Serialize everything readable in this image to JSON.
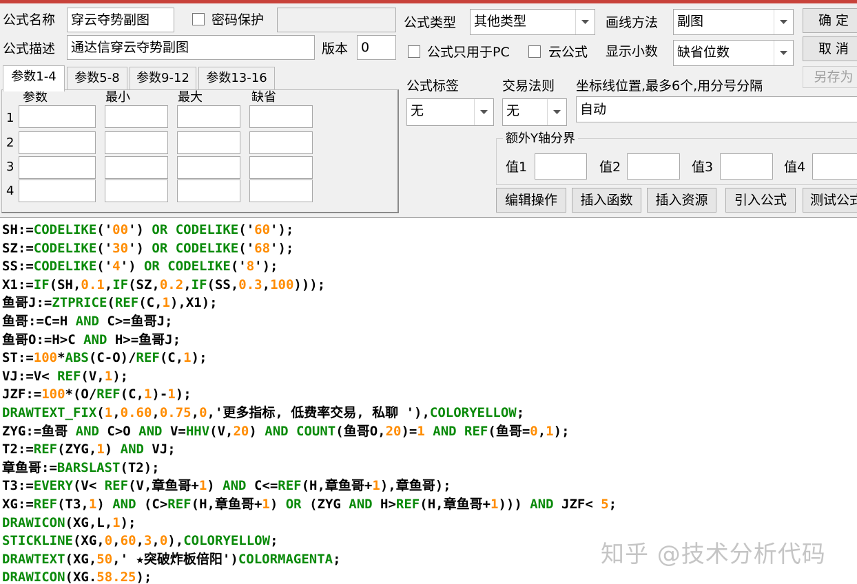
{
  "form": {
    "name_label": "公式名称",
    "name_value": "穿云夺势副图",
    "password_label": "密码保护",
    "password_value": "",
    "desc_label": "公式描述",
    "desc_value": "通达信穿云夺势副图",
    "version_label": "版本",
    "version_value": "0",
    "type_label": "公式类型",
    "type_value": "其他类型",
    "draw_label": "画线方法",
    "draw_value": "副图",
    "pc_only_label": "公式只用于PC",
    "cloud_label": "云公式",
    "decimals_label": "显示小数",
    "decimals_value": "缺省位数",
    "tag_label": "公式标签",
    "tag_value": "无",
    "trade_label": "交易法则",
    "trade_value": "无",
    "axis_label": "坐标线位置,最多6个,用分号分隔",
    "axis_value": "自动"
  },
  "buttons": {
    "ok": "确 定",
    "cancel": "取 消",
    "save_as": "另存为",
    "edit_op": "编辑操作",
    "insert_func": "插入函数",
    "insert_res": "插入资源",
    "import_formula": "引入公式",
    "test_formula": "测试公式"
  },
  "tabs": [
    "参数1-4",
    "参数5-8",
    "参数9-12",
    "参数13-16"
  ],
  "params": {
    "col_param": "参数",
    "col_min": "最小",
    "col_max": "最大",
    "col_default": "缺省",
    "rows": [
      "1",
      "2",
      "3",
      "4"
    ]
  },
  "yaxis": {
    "title": "额外Y轴分界",
    "v1": "值1",
    "v2": "值2",
    "v3": "值3",
    "v4": "值4"
  },
  "colors": {
    "keyword": "#0a8a0a",
    "number": "#ff8c00",
    "text": "#000000",
    "accent": "#c8423a"
  },
  "code_lines": [
    [
      [
        "SH:=",
        "t"
      ],
      [
        "CODELIKE",
        "k"
      ],
      [
        "('",
        "t"
      ],
      [
        "00",
        "n"
      ],
      [
        "') ",
        "t"
      ],
      [
        "OR",
        "k"
      ],
      [
        " ",
        "t"
      ],
      [
        "CODELIKE",
        "k"
      ],
      [
        "('",
        "t"
      ],
      [
        "60",
        "n"
      ],
      [
        "');",
        "t"
      ]
    ],
    [
      [
        "SZ:=",
        "t"
      ],
      [
        "CODELIKE",
        "k"
      ],
      [
        "('",
        "t"
      ],
      [
        "30",
        "n"
      ],
      [
        "') ",
        "t"
      ],
      [
        "OR",
        "k"
      ],
      [
        " ",
        "t"
      ],
      [
        "CODELIKE",
        "k"
      ],
      [
        "('",
        "t"
      ],
      [
        "68",
        "n"
      ],
      [
        "');",
        "t"
      ]
    ],
    [
      [
        "SS:=",
        "t"
      ],
      [
        "CODELIKE",
        "k"
      ],
      [
        "('",
        "t"
      ],
      [
        "4",
        "n"
      ],
      [
        "') ",
        "t"
      ],
      [
        "OR",
        "k"
      ],
      [
        " ",
        "t"
      ],
      [
        "CODELIKE",
        "k"
      ],
      [
        "('",
        "t"
      ],
      [
        "8",
        "n"
      ],
      [
        "');",
        "t"
      ]
    ],
    [
      [
        "X1:=",
        "t"
      ],
      [
        "IF",
        "k"
      ],
      [
        "(SH,",
        "t"
      ],
      [
        "0.1",
        "n"
      ],
      [
        ",",
        "t"
      ],
      [
        "IF",
        "k"
      ],
      [
        "(SZ,",
        "t"
      ],
      [
        "0.2",
        "n"
      ],
      [
        ",",
        "t"
      ],
      [
        "IF",
        "k"
      ],
      [
        "(SS,",
        "t"
      ],
      [
        "0.3",
        "n"
      ],
      [
        ",",
        "t"
      ],
      [
        "100",
        "n"
      ],
      [
        ")));",
        "t"
      ]
    ],
    [
      [
        "鱼哥J:=",
        "t"
      ],
      [
        "ZTPRICE",
        "k"
      ],
      [
        "(",
        "t"
      ],
      [
        "REF",
        "k"
      ],
      [
        "(C,",
        "t"
      ],
      [
        "1",
        "n"
      ],
      [
        "),X1);",
        "t"
      ]
    ],
    [
      [
        "鱼哥:=C=H ",
        "t"
      ],
      [
        "AND",
        "k"
      ],
      [
        " C>=鱼哥J;",
        "t"
      ]
    ],
    [
      [
        "鱼哥O:=H>C ",
        "t"
      ],
      [
        "AND",
        "k"
      ],
      [
        " H>=鱼哥J;",
        "t"
      ]
    ],
    [
      [
        "ST:=",
        "t"
      ],
      [
        "100",
        "n"
      ],
      [
        "*",
        "t"
      ],
      [
        "ABS",
        "k"
      ],
      [
        "(C-O)/",
        "t"
      ],
      [
        "REF",
        "k"
      ],
      [
        "(C,",
        "t"
      ],
      [
        "1",
        "n"
      ],
      [
        ");",
        "t"
      ]
    ],
    [
      [
        "VJ:=V< ",
        "t"
      ],
      [
        "REF",
        "k"
      ],
      [
        "(V,",
        "t"
      ],
      [
        "1",
        "n"
      ],
      [
        ");",
        "t"
      ]
    ],
    [
      [
        "JZF:=",
        "t"
      ],
      [
        "100",
        "n"
      ],
      [
        "*(O/",
        "t"
      ],
      [
        "REF",
        "k"
      ],
      [
        "(C,",
        "t"
      ],
      [
        "1",
        "n"
      ],
      [
        ")-",
        "t"
      ],
      [
        "1",
        "n"
      ],
      [
        ");",
        "t"
      ]
    ],
    [
      [
        "DRAWTEXT_FIX",
        "k"
      ],
      [
        "(",
        "t"
      ],
      [
        "1",
        "n"
      ],
      [
        ",",
        "t"
      ],
      [
        "0.60",
        "n"
      ],
      [
        ",",
        "t"
      ],
      [
        "0.75",
        "n"
      ],
      [
        ",",
        "t"
      ],
      [
        "0",
        "n"
      ],
      [
        ",'更多指标, 低费率交易, 私聊 '),",
        "t"
      ],
      [
        "COLORYELLOW",
        "k"
      ],
      [
        ";",
        "t"
      ]
    ],
    [
      [
        "ZYG:=鱼哥 ",
        "t"
      ],
      [
        "AND",
        "k"
      ],
      [
        " C>O ",
        "t"
      ],
      [
        "AND",
        "k"
      ],
      [
        " V=",
        "t"
      ],
      [
        "HHV",
        "k"
      ],
      [
        "(V,",
        "t"
      ],
      [
        "20",
        "n"
      ],
      [
        ") ",
        "t"
      ],
      [
        "AND",
        "k"
      ],
      [
        " ",
        "t"
      ],
      [
        "COUNT",
        "k"
      ],
      [
        "(鱼哥O,",
        "t"
      ],
      [
        "20",
        "n"
      ],
      [
        ")=",
        "t"
      ],
      [
        "1",
        "n"
      ],
      [
        " ",
        "t"
      ],
      [
        "AND",
        "k"
      ],
      [
        " ",
        "t"
      ],
      [
        "REF",
        "k"
      ],
      [
        "(鱼哥=",
        "t"
      ],
      [
        "0",
        "n"
      ],
      [
        ",",
        "t"
      ],
      [
        "1",
        "n"
      ],
      [
        ");",
        "t"
      ]
    ],
    [
      [
        "T2:=",
        "t"
      ],
      [
        "REF",
        "k"
      ],
      [
        "(ZYG,",
        "t"
      ],
      [
        "1",
        "n"
      ],
      [
        ") ",
        "t"
      ],
      [
        "AND",
        "k"
      ],
      [
        " VJ;",
        "t"
      ]
    ],
    [
      [
        "章鱼哥:=",
        "t"
      ],
      [
        "BARSLAST",
        "k"
      ],
      [
        "(T2);",
        "t"
      ]
    ],
    [
      [
        "T3:=",
        "t"
      ],
      [
        "EVERY",
        "k"
      ],
      [
        "(V< ",
        "t"
      ],
      [
        "REF",
        "k"
      ],
      [
        "(V,章鱼哥+",
        "t"
      ],
      [
        "1",
        "n"
      ],
      [
        ") ",
        "t"
      ],
      [
        "AND",
        "k"
      ],
      [
        " C<=",
        "t"
      ],
      [
        "REF",
        "k"
      ],
      [
        "(H,章鱼哥+",
        "t"
      ],
      [
        "1",
        "n"
      ],
      [
        "),章鱼哥);",
        "t"
      ]
    ],
    [
      [
        "XG:=",
        "t"
      ],
      [
        "REF",
        "k"
      ],
      [
        "(T3,",
        "t"
      ],
      [
        "1",
        "n"
      ],
      [
        ") ",
        "t"
      ],
      [
        "AND",
        "k"
      ],
      [
        " (C>",
        "t"
      ],
      [
        "REF",
        "k"
      ],
      [
        "(H,章鱼哥+",
        "t"
      ],
      [
        "1",
        "n"
      ],
      [
        ") ",
        "t"
      ],
      [
        "OR",
        "k"
      ],
      [
        " (ZYG ",
        "t"
      ],
      [
        "AND",
        "k"
      ],
      [
        " H>",
        "t"
      ],
      [
        "REF",
        "k"
      ],
      [
        "(H,章鱼哥+",
        "t"
      ],
      [
        "1",
        "n"
      ],
      [
        "))) ",
        "t"
      ],
      [
        "AND",
        "k"
      ],
      [
        " JZF< ",
        "t"
      ],
      [
        "5",
        "n"
      ],
      [
        ";",
        "t"
      ]
    ],
    [
      [
        "DRAWICON",
        "k"
      ],
      [
        "(XG,L,",
        "t"
      ],
      [
        "1",
        "n"
      ],
      [
        ");",
        "t"
      ]
    ],
    [
      [
        "STICKLINE",
        "k"
      ],
      [
        "(XG,",
        "t"
      ],
      [
        "0",
        "n"
      ],
      [
        ",",
        "t"
      ],
      [
        "60",
        "n"
      ],
      [
        ",",
        "t"
      ],
      [
        "3",
        "n"
      ],
      [
        ",",
        "t"
      ],
      [
        "0",
        "n"
      ],
      [
        "),",
        "t"
      ],
      [
        "COLORYELLOW",
        "k"
      ],
      [
        ";",
        "t"
      ]
    ],
    [
      [
        "DRAWTEXT",
        "k"
      ],
      [
        "(XG,",
        "t"
      ],
      [
        "50",
        "n"
      ],
      [
        ",' ★突破炸板倍阳')",
        "t"
      ],
      [
        "COLORMAGENTA",
        "k"
      ],
      [
        ";",
        "t"
      ]
    ],
    [
      [
        "DRAWICON",
        "k"
      ],
      [
        "(XG.",
        "t"
      ],
      [
        "58.25",
        "n"
      ],
      [
        ");",
        "t"
      ]
    ]
  ],
  "watermark": "知乎 @技术分析代码"
}
